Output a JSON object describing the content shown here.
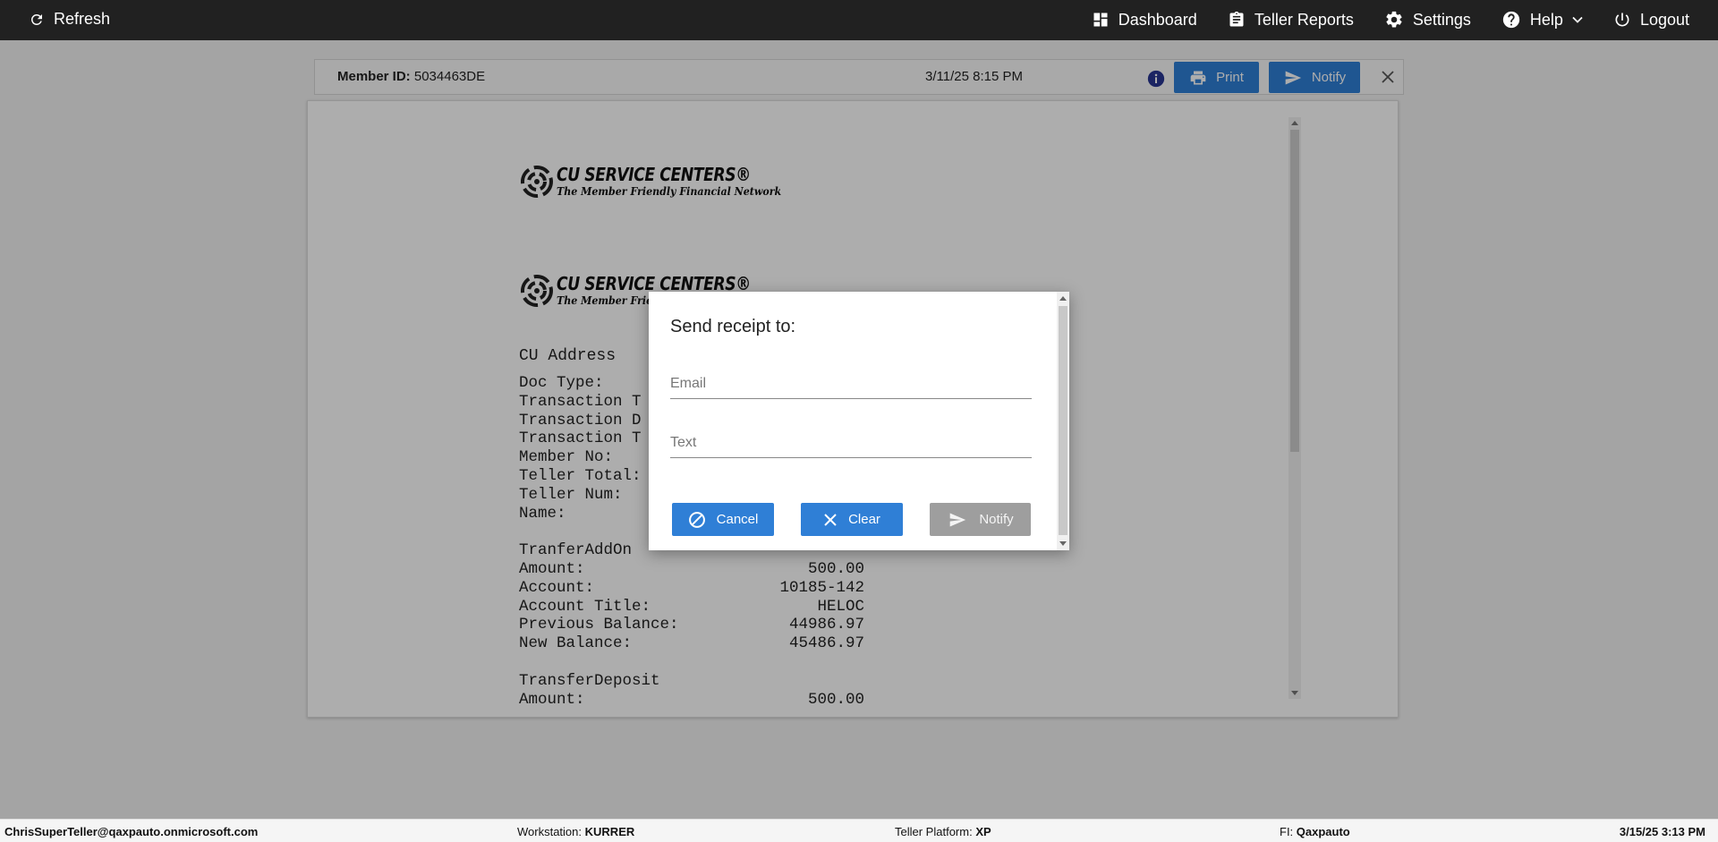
{
  "nav": {
    "refresh": "Refresh",
    "dashboard": "Dashboard",
    "teller_reports": "Teller Reports",
    "settings": "Settings",
    "help": "Help",
    "logout": "Logout"
  },
  "header": {
    "member_label": "Member ID:",
    "member_id": "5034463DE",
    "datetime": "3/11/25 8:15 PM",
    "print": "Print",
    "notify": "Notify"
  },
  "receipt": {
    "logo_main": "CU SERVICE CENTERS®",
    "logo_sub": "The Member Friendly Financial Network",
    "logo_main_partial": "CU SERVICE CENTERS®",
    "logo_sub_partial": "The Member Friendly",
    "cu_address": "CU Address",
    "lines": [
      {
        "label": "Doc Type:",
        "value": ""
      },
      {
        "label": "Transaction T",
        "value": ""
      },
      {
        "label": "Transaction D",
        "value": ""
      },
      {
        "label": "Transaction T",
        "value": ""
      },
      {
        "label": "Member No:",
        "value": ""
      },
      {
        "label": "Teller Total:",
        "value": ""
      },
      {
        "label": "Teller Num:",
        "value": ""
      },
      {
        "label": "Name:",
        "value": ""
      },
      {
        "label": "",
        "value": ""
      },
      {
        "label": "TranferAddOn",
        "value": ""
      },
      {
        "label": "Amount:",
        "value": "500.00"
      },
      {
        "label": "Account:",
        "value": "10185-142"
      },
      {
        "label": "Account Title:",
        "value": "HELOC"
      },
      {
        "label": "Previous Balance:",
        "value": "44986.97"
      },
      {
        "label": "New Balance:",
        "value": "45486.97"
      },
      {
        "label": "",
        "value": ""
      },
      {
        "label": "TransferDeposit",
        "value": ""
      },
      {
        "label": "Amount:",
        "value": "500.00"
      }
    ]
  },
  "modal": {
    "title": "Send receipt to:",
    "email_placeholder": "Email",
    "email_value": "",
    "text_placeholder": "Text",
    "text_value": "",
    "cancel": "Cancel",
    "clear": "Clear",
    "notify": "Notify"
  },
  "footer": {
    "user": "ChrisSuperTeller@qaxpauto.onmicrosoft.com",
    "workstation_label": "Workstation:",
    "workstation": "KURRER",
    "platform_label": "Teller Platform:",
    "platform": "XP",
    "fi_label": "FI:",
    "fi": "Qaxpauto",
    "timestamp": "3/15/25 3:13 PM"
  },
  "colors": {
    "topbar": "#212121",
    "primary_button": "#2f7fd6",
    "disabled_button": "#9e9e9e",
    "info_icon": "#283593"
  }
}
